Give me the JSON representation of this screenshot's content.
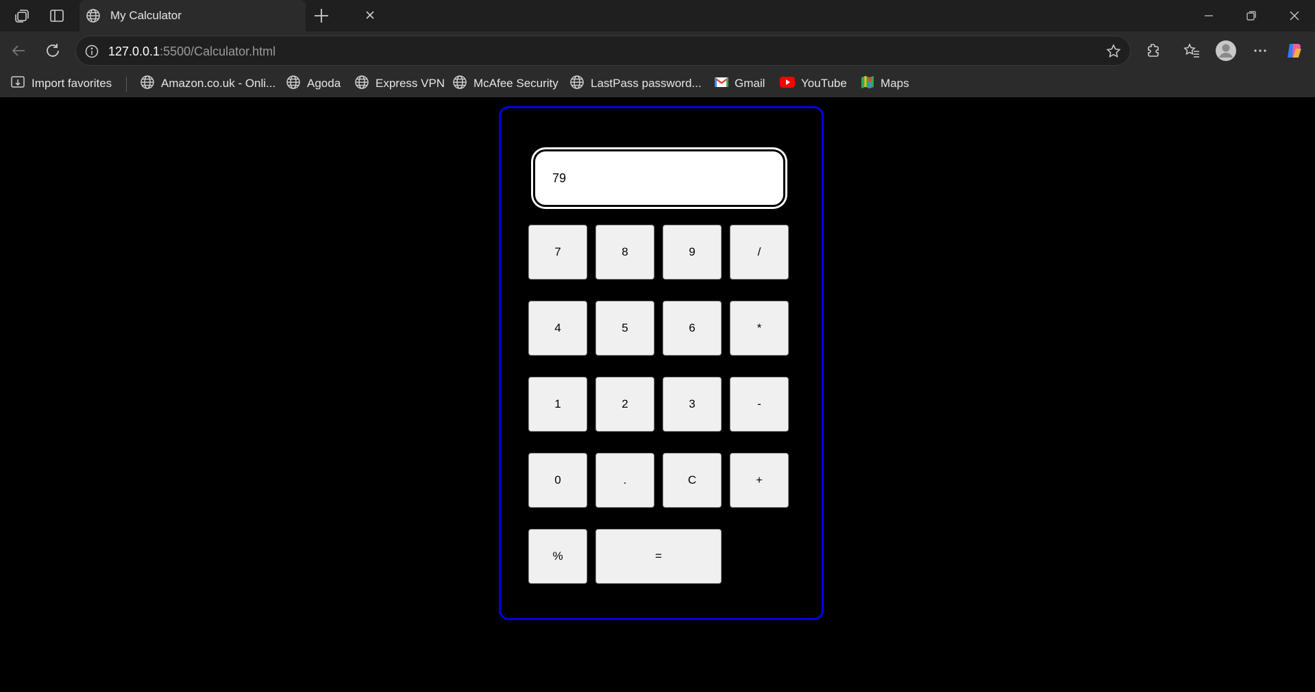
{
  "browser": {
    "tab_title": "My Calculator",
    "url_host": "127.0.0.1",
    "url_rest": ":5500/Calculator.html",
    "bookmarks": [
      {
        "label": "Import favorites",
        "icon": "import-icon"
      },
      {
        "label": "Amazon.co.uk - Onli...",
        "icon": "globe-icon"
      },
      {
        "label": "Agoda",
        "icon": "globe-icon"
      },
      {
        "label": "Express VPN",
        "icon": "globe-icon"
      },
      {
        "label": "McAfee Security",
        "icon": "globe-icon"
      },
      {
        "label": "LastPass password...",
        "icon": "globe-icon"
      },
      {
        "label": "Gmail",
        "icon": "gmail-icon"
      },
      {
        "label": "YouTube",
        "icon": "youtube-icon"
      },
      {
        "label": "Maps",
        "icon": "maps-icon"
      }
    ]
  },
  "calculator": {
    "display_value": "79",
    "border_color": "#0000e6",
    "keys": {
      "k7": "7",
      "k8": "8",
      "k9": "9",
      "divide": "/",
      "k4": "4",
      "k5": "5",
      "k6": "6",
      "multiply": "*",
      "k1": "1",
      "k2": "2",
      "k3": "3",
      "subtract": "-",
      "k0": "0",
      "decimal": ".",
      "clear": "C",
      "add": "+",
      "percent": "%",
      "equals": "="
    }
  }
}
